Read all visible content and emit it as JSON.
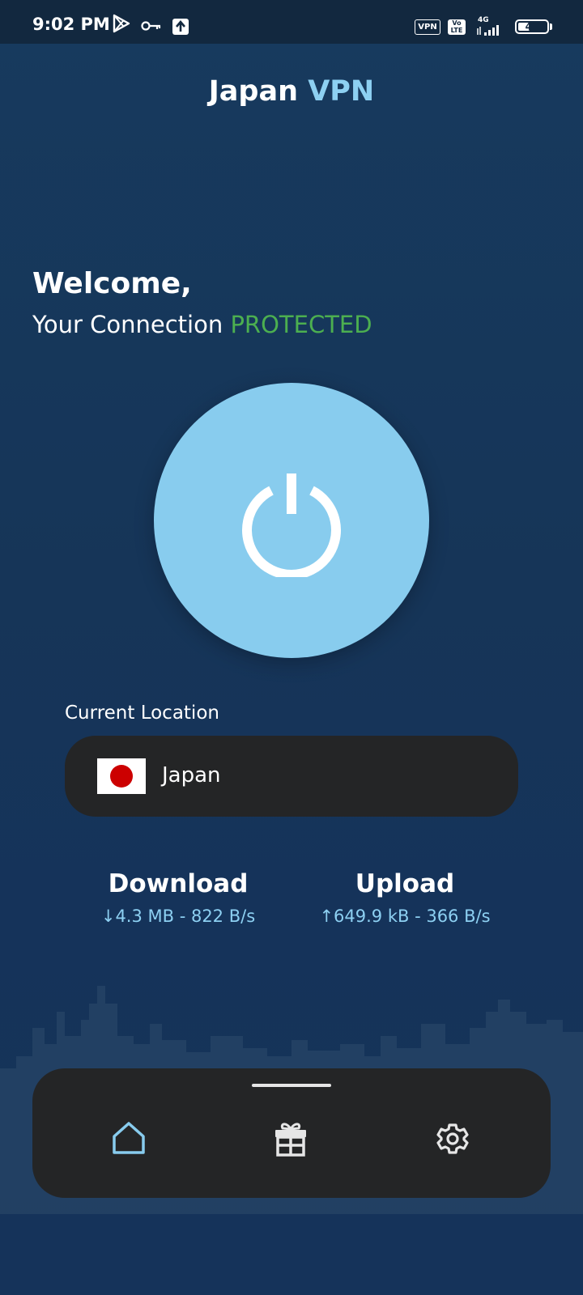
{
  "status_bar": {
    "time": "9:02 PM",
    "icons": [
      "play-store-icon",
      "key-icon",
      "upload-icon"
    ],
    "vpn_label": "VPN",
    "volte_top": "Vo",
    "volte_bottom": "LTE",
    "network_label": "4G",
    "battery_level": "41",
    "battery_fraction": 0.41
  },
  "header": {
    "title_main": "Japan",
    "title_accent": "VPN",
    "accent_color": "#8dd0f2"
  },
  "welcome": {
    "greeting": "Welcome,",
    "connection_prefix": "Your Connection",
    "connection_status": "PROTECTED",
    "status_color": "#4caf50"
  },
  "power_button": {
    "icon": "power-icon",
    "color": "#88ccee"
  },
  "location": {
    "label": "Current Location",
    "country": "Japan",
    "flag_icon": "japan-flag-icon"
  },
  "stats": {
    "download": {
      "title": "Download",
      "value": "↓4.3 MB - 822 B/s"
    },
    "upload": {
      "title": "Upload",
      "value": "↑649.9 kB - 366 B/s"
    }
  },
  "bottom_nav": {
    "items": [
      {
        "name": "home",
        "icon": "home-icon",
        "active": true
      },
      {
        "name": "gift",
        "icon": "gift-icon",
        "active": false
      },
      {
        "name": "settings",
        "icon": "gear-icon",
        "active": false
      }
    ],
    "active_color": "#88ccee",
    "inactive_color": "#e6e6e6"
  }
}
